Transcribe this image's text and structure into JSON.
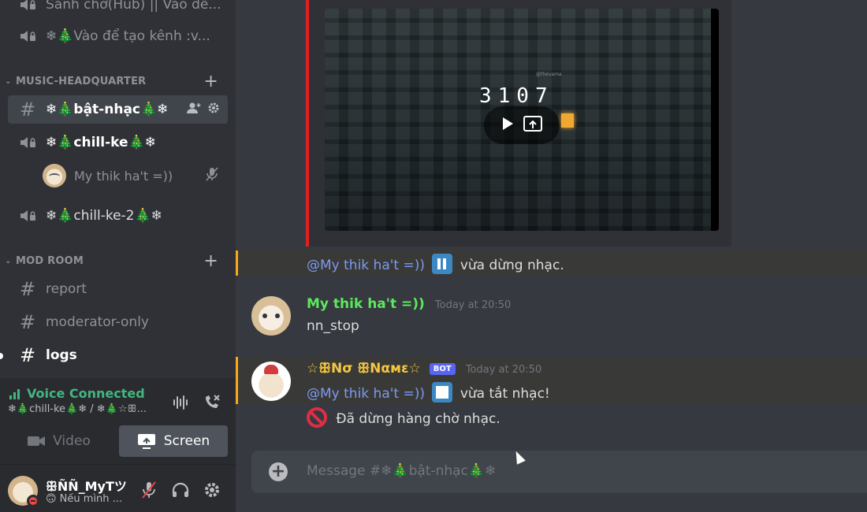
{
  "sidebar": {
    "top_channels": [
      {
        "label": "Sảnh chờ(Hub) || Vào để...",
        "icon": "speaker-lock-icon"
      },
      {
        "label": "❄🎄Vào để tạo kênh :v...",
        "icon": "speaker-lock-icon"
      }
    ],
    "categories": [
      {
        "label": "MUSIC-HEADQUARTER",
        "channels": [
          {
            "label": "❄🎄bật-nhạc🎄❄",
            "type": "text",
            "active": true
          },
          {
            "label": "❄🎄chill-ke🎄❄",
            "type": "voice"
          },
          {
            "label": "❄🎄chill-ke-2🎄❄",
            "type": "voice"
          }
        ],
        "voice_user": "My thik ha't =))"
      },
      {
        "label": "MOD ROOM",
        "channels": [
          {
            "label": "report",
            "type": "text"
          },
          {
            "label": "moderator-only",
            "type": "text"
          },
          {
            "label": "logs",
            "type": "text",
            "unread": true
          }
        ]
      }
    ],
    "voice_panel": {
      "status": "Voice Connected",
      "channel": "❄🎄chill-ke🎄❄ / ❄🎄☆ꕥ...",
      "video_label": "Video",
      "screen_label": "Screen"
    },
    "user": {
      "name": "ꕥÑÑ_MyTツ",
      "status": "🙃 Nếu mình ..."
    }
  },
  "embed": {
    "countdown": "3107",
    "watermark": "@thevama"
  },
  "messages": [
    {
      "mention": "@My thik ha't =))",
      "text": "vừa dừng nhạc."
    },
    {
      "author": "My thik ha't =))",
      "timestamp": "Today at 20:50",
      "text": "nn_stop"
    },
    {
      "author": "☆ꕥNσ ꕥNαмε☆",
      "bot_tag": "BOT",
      "timestamp": "Today at 20:50",
      "mention": "@My thik ha't =))",
      "text": "vừa tắt nhạc!",
      "line2": "Đã dừng hàng chờ nhạc."
    }
  ],
  "composer": {
    "placeholder": "Message #❄🎄bật-nhạc🎄❄"
  }
}
